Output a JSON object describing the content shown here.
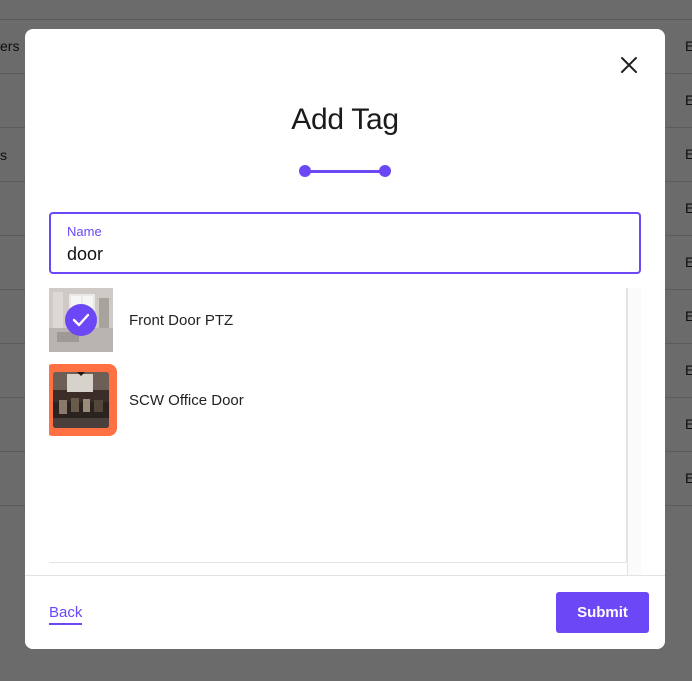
{
  "background": {
    "left_fragments": [
      "ers",
      "s"
    ],
    "right_fragments": [
      "E",
      "E",
      "E",
      "E",
      "E",
      "E",
      "E",
      "E",
      "E"
    ]
  },
  "modal": {
    "title": "Add Tag",
    "close_icon": "close-icon",
    "step_count": 2,
    "name_field": {
      "label": "Name",
      "value": "door"
    },
    "cameras": [
      {
        "name": "Front Door PTZ",
        "selected": true,
        "focused": false
      },
      {
        "name": "SCW Office Door",
        "selected": false,
        "focused": true
      }
    ],
    "footer": {
      "back_label": "Back",
      "submit_label": "Submit"
    }
  },
  "colors": {
    "accent": "#6b47f5",
    "focus": "#ff7043",
    "overlay": "rgba(0,0,0,0.58)"
  }
}
